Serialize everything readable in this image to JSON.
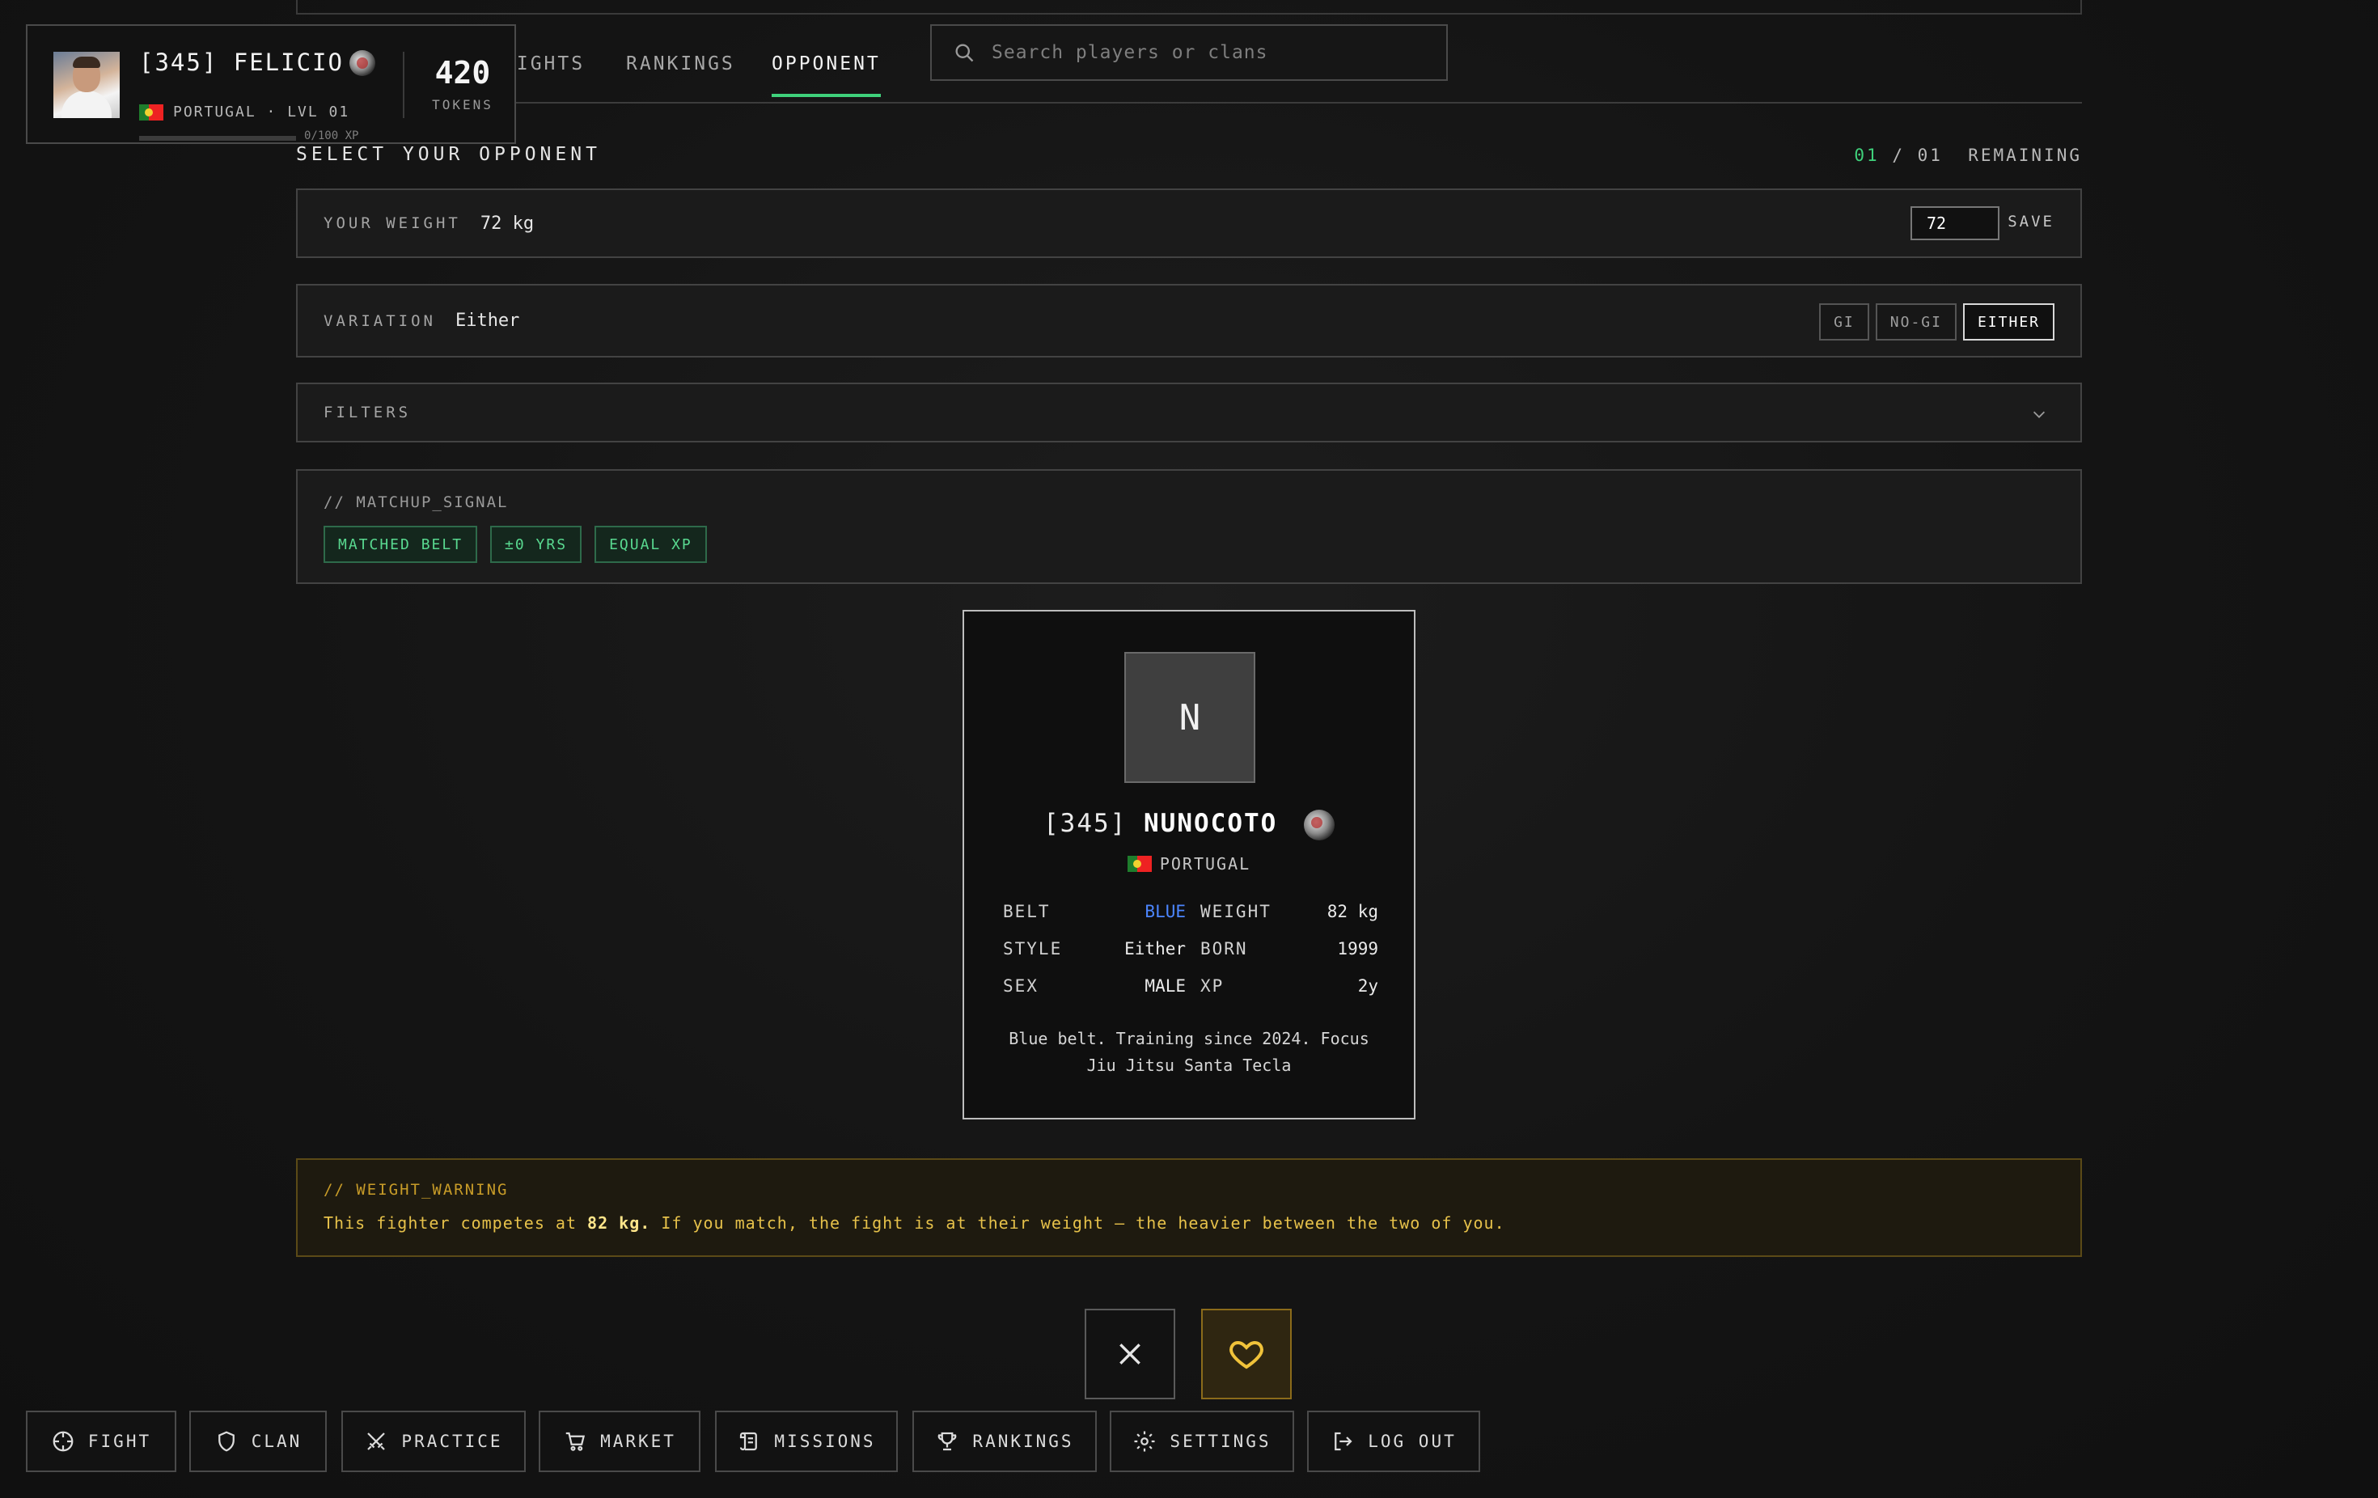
{
  "profile": {
    "name": "[345] FELICIO",
    "country_level": "PORTUGAL · LVL 01",
    "xp_progress": "0/100 XP",
    "xp_fraction": 0,
    "tokens": "420",
    "tokens_label": "TOKENS"
  },
  "nav": {
    "tabs": [
      {
        "label": "FIGHTS"
      },
      {
        "label": "RANKINGS"
      },
      {
        "label": "OPPONENT"
      }
    ],
    "active_tab": "OPPONENT",
    "search_placeholder": "Search players or clans"
  },
  "selection": {
    "title": "SELECT YOUR OPPONENT",
    "remaining_current": "01",
    "remaining_sep": " / ",
    "remaining_total": "01",
    "remaining_label": "REMAINING"
  },
  "weight": {
    "label": "YOUR WEIGHT",
    "value": "72 kg",
    "input_value": "72",
    "save_label": "SAVE"
  },
  "variation": {
    "label": "VARIATION",
    "value": "Either",
    "options": [
      "GI",
      "NO-GI",
      "EITHER"
    ],
    "selected": "EITHER"
  },
  "filters": {
    "label": "FILTERS"
  },
  "matchup": {
    "title": "// MATCHUP_SIGNAL",
    "chips": [
      "MATCHED BELT",
      "±0 YRS",
      "EQUAL XP"
    ]
  },
  "opponent": {
    "initial": "N",
    "tag": "[345]",
    "nick": "NUNOCOTO",
    "country": "PORTUGAL",
    "stats": {
      "belt_label": "BELT",
      "belt": "BLUE",
      "weight_label": "WEIGHT",
      "weight": "82 kg",
      "style_label": "STYLE",
      "style": "Either",
      "born_label": "BORN",
      "born": "1999",
      "sex_label": "SEX",
      "sex": "MALE",
      "xp_label": "XP",
      "xp": "2y"
    },
    "bio": "Blue belt. Training since 2024. Focus Jiu Jitsu Santa Tecla"
  },
  "warning": {
    "title": "// WEIGHT_WARNING",
    "text_pre": "This fighter competes at ",
    "text_bold": "82 kg.",
    "text_post": " If you match, the fight is at their weight — the heavier between the two of you."
  },
  "dock": {
    "fight": "FIGHT",
    "clan": "CLAN",
    "practice": "PRACTICE",
    "market": "MARKET",
    "missions": "MISSIONS",
    "rankings": "RANKINGS",
    "settings": "SETTINGS",
    "logout": "LOG OUT"
  },
  "colors": {
    "accent_green": "#3fd17b",
    "belt_blue": "#4c86ff",
    "warning_gold": "#e6c14a"
  }
}
